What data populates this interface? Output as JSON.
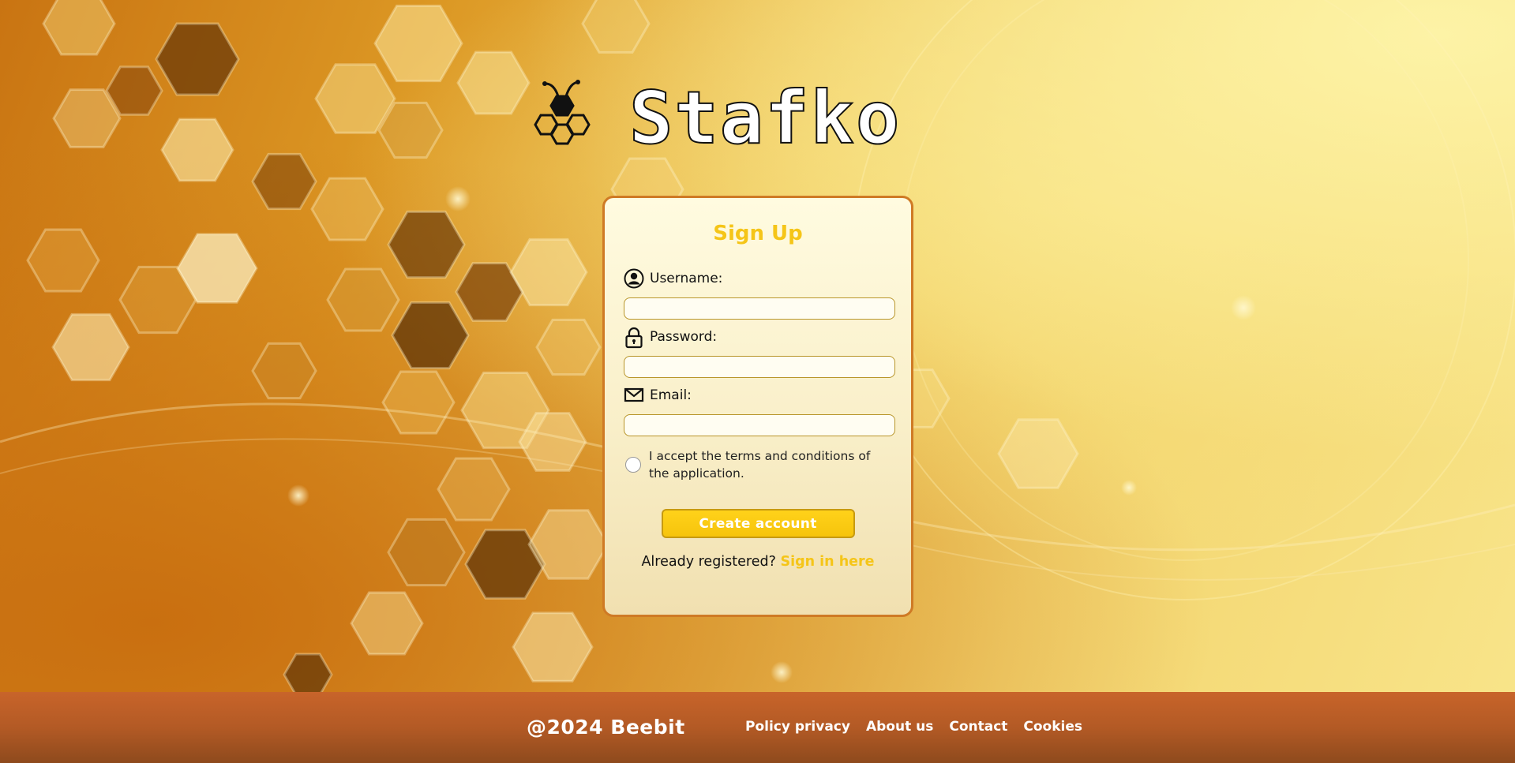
{
  "brand": {
    "name": "Stafko"
  },
  "form": {
    "title": "Sign Up",
    "username_label": "Username:",
    "username_value": "",
    "password_label": "Password:",
    "password_value": "",
    "email_label": "Email:",
    "email_value": "",
    "terms_text": "I accept the terms and conditions of the application.",
    "submit_label": "Create account",
    "signin_prompt": "Already registered?",
    "signin_link": "Sign in here"
  },
  "footer": {
    "copyright": "@2024 Beebit",
    "links": [
      "Policy privacy",
      "About us",
      "Contact",
      "Cookies"
    ]
  },
  "colors": {
    "accent": "#f5c518",
    "card_border": "#cf7a25",
    "footer": "#b35a25"
  },
  "icons": {
    "logo": "bee-hexagon-icon",
    "username": "user-circle-icon",
    "password": "lock-icon",
    "email": "envelope-icon"
  }
}
